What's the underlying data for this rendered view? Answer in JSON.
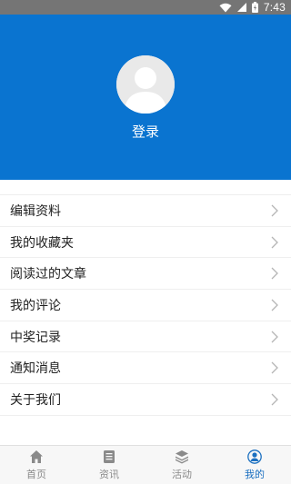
{
  "status_bar": {
    "time": "7:43",
    "icons": [
      "wifi-icon",
      "signal-icon",
      "battery-icon"
    ]
  },
  "profile": {
    "avatar_icon": "default-user-avatar",
    "login_label": "登录",
    "header_color": "#0a74d0"
  },
  "menu": {
    "items": [
      {
        "label": "编辑资料"
      },
      {
        "label": "我的收藏夹"
      },
      {
        "label": "阅读过的文章"
      },
      {
        "label": "我的评论"
      },
      {
        "label": "中奖记录"
      },
      {
        "label": "通知消息"
      },
      {
        "label": "关于我们"
      }
    ],
    "chevron_icon": "chevron-right-icon"
  },
  "tabbar": {
    "tabs": [
      {
        "label": "首页",
        "icon": "home-icon",
        "active": false
      },
      {
        "label": "资讯",
        "icon": "news-icon",
        "active": false
      },
      {
        "label": "活动",
        "icon": "layers-icon",
        "active": false
      },
      {
        "label": "我的",
        "icon": "user-icon",
        "active": true
      }
    ],
    "active_color": "#1a6fc0"
  }
}
